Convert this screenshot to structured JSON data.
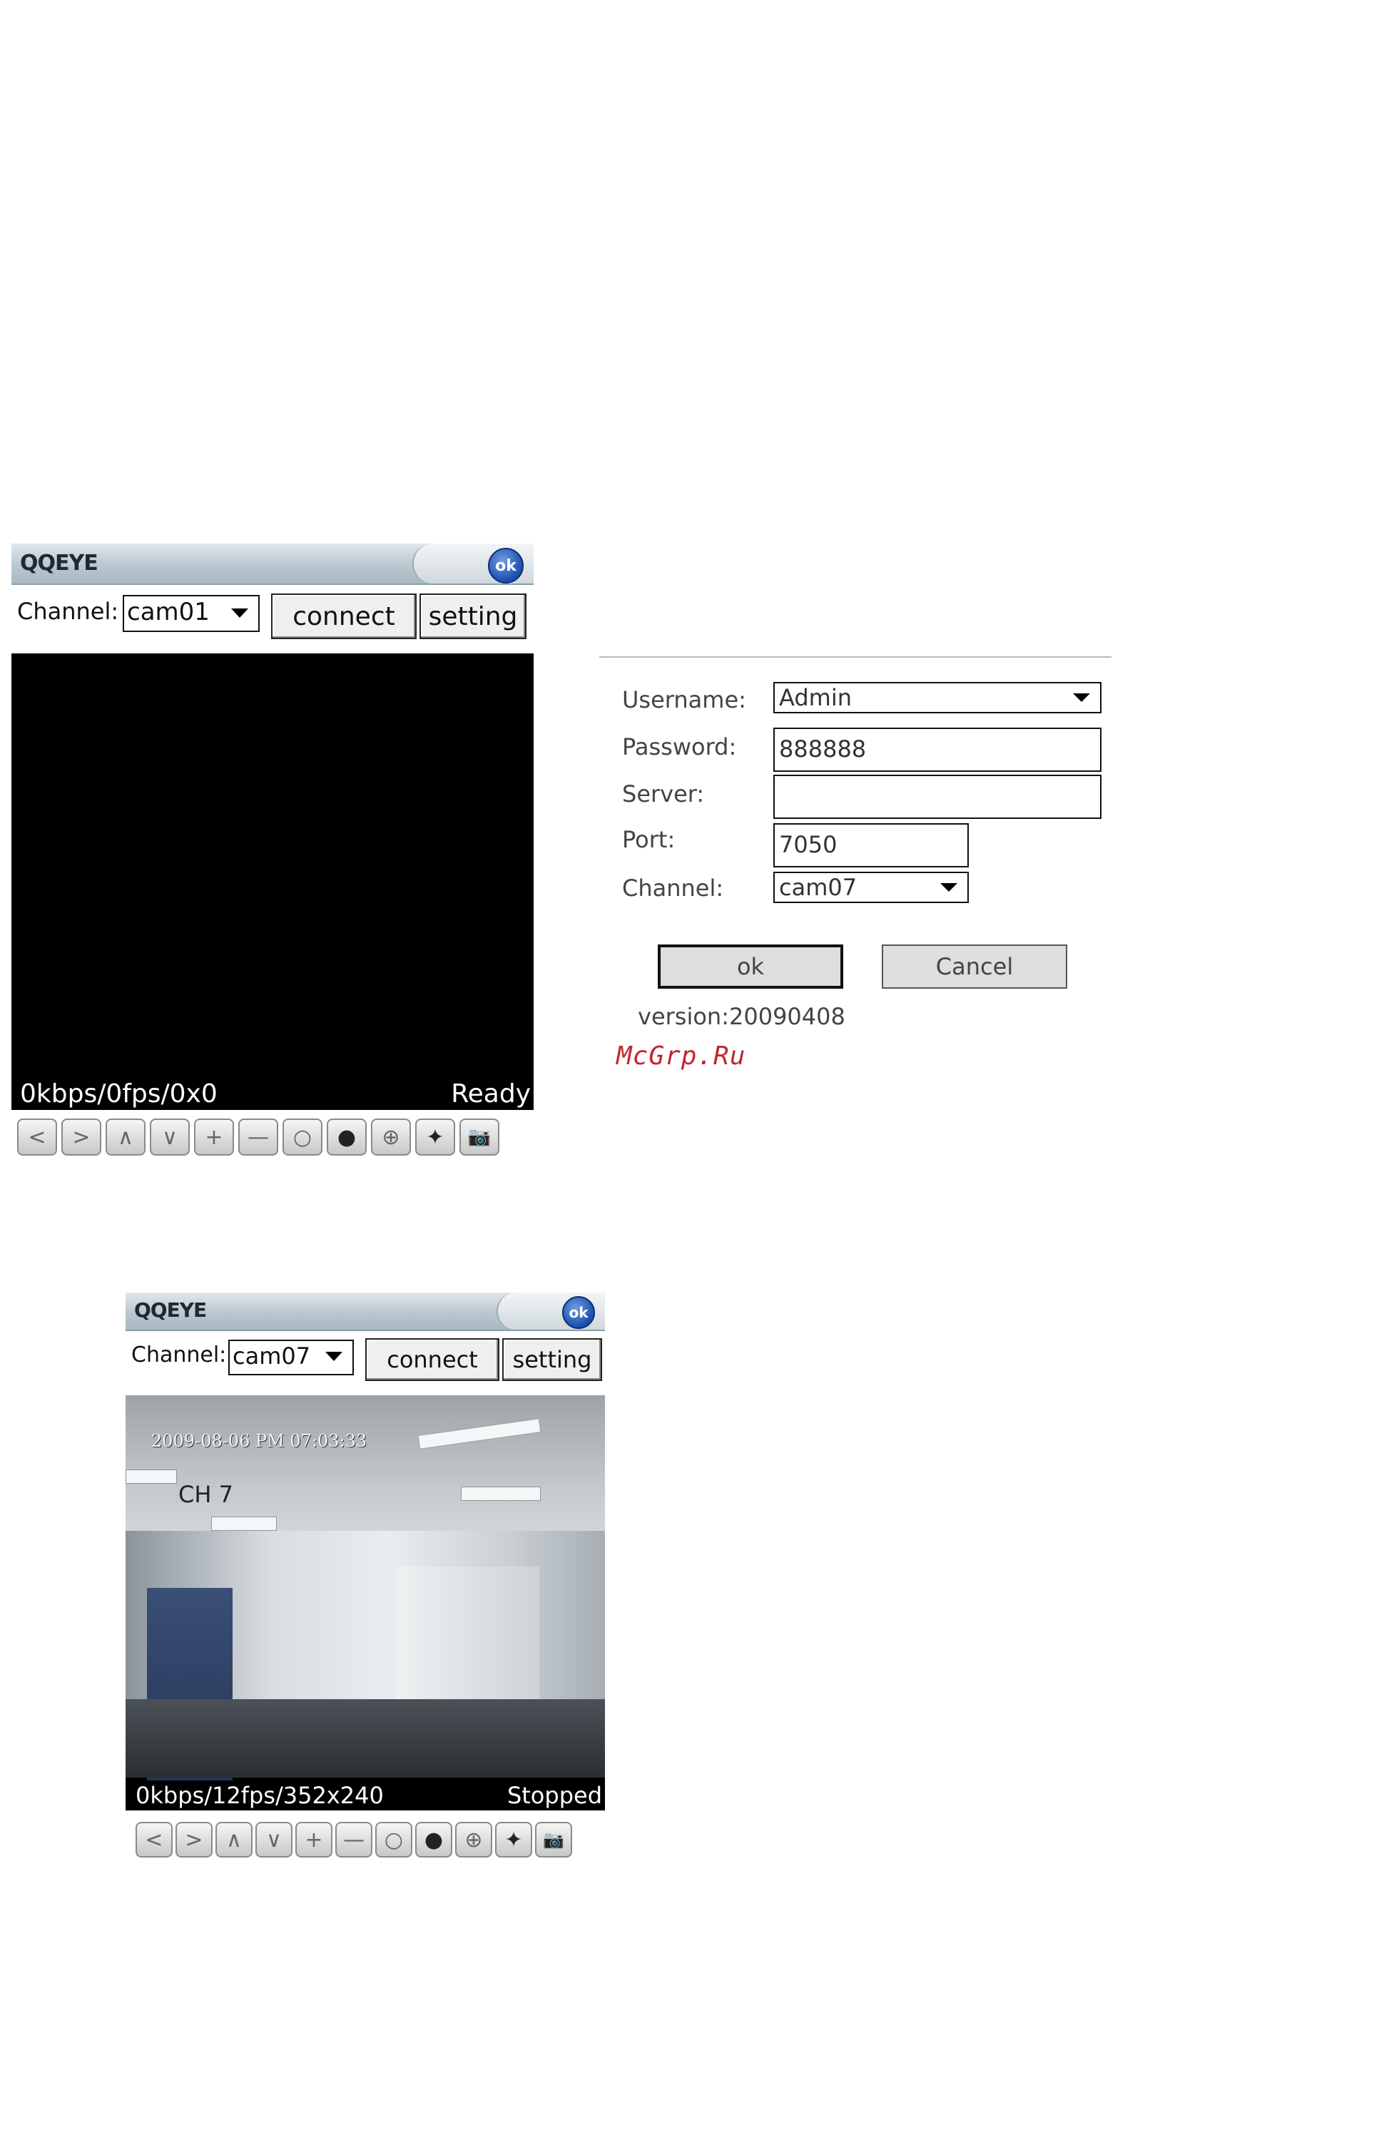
{
  "colors": {
    "titlebar": "#b9c7cf",
    "ok_badge": "#1b4fae",
    "watermark": "#c0282d"
  },
  "icons": [
    "left-arrow-icon",
    "right-arrow-icon",
    "up-arrow-icon",
    "down-arrow-icon",
    "zoom-in-icon",
    "zoom-out-icon",
    "circle-icon",
    "record-icon",
    "crosshair-icon",
    "diamond-icon",
    "camera-icon"
  ],
  "screen1": {
    "app_title": "QQEYE",
    "ok_badge": "ok",
    "channel_label": "Channel:",
    "channel_value": "cam01",
    "connect_label": "connect",
    "setting_label": "setting",
    "status_left": "0kbps/0fps/0x0",
    "status_right": "Ready",
    "toolbar": [
      "<",
      ">",
      "∧",
      "∨",
      "+",
      "—",
      "○",
      "●",
      "⊕",
      "✦",
      "📷"
    ]
  },
  "settings": {
    "username_label": "Username:",
    "username_value": "Admin",
    "password_label": "Password:",
    "password_value": "888888",
    "server_label": "Server:",
    "server_value": "",
    "port_label": "Port:",
    "port_value": "7050",
    "channel_label": "Channel:",
    "channel_value": "cam07",
    "ok_label": "ok",
    "cancel_label": "Cancel",
    "version": "version:20090408",
    "watermark": "McGrp.Ru"
  },
  "screen2": {
    "app_title": "QQEYE",
    "ok_badge": "ok",
    "channel_label": "Channel:",
    "channel_value": "cam07",
    "connect_label": "connect",
    "setting_label": "setting",
    "osd_timestamp": "2009-08-06 PM 07:03:33",
    "osd_channel": "CH 7",
    "status_left": "0kbps/12fps/352x240",
    "status_right": "Stopped",
    "toolbar": [
      "<",
      ">",
      "∧",
      "∨",
      "+",
      "—",
      "○",
      "●",
      "⊕",
      "✦",
      "📷"
    ]
  }
}
